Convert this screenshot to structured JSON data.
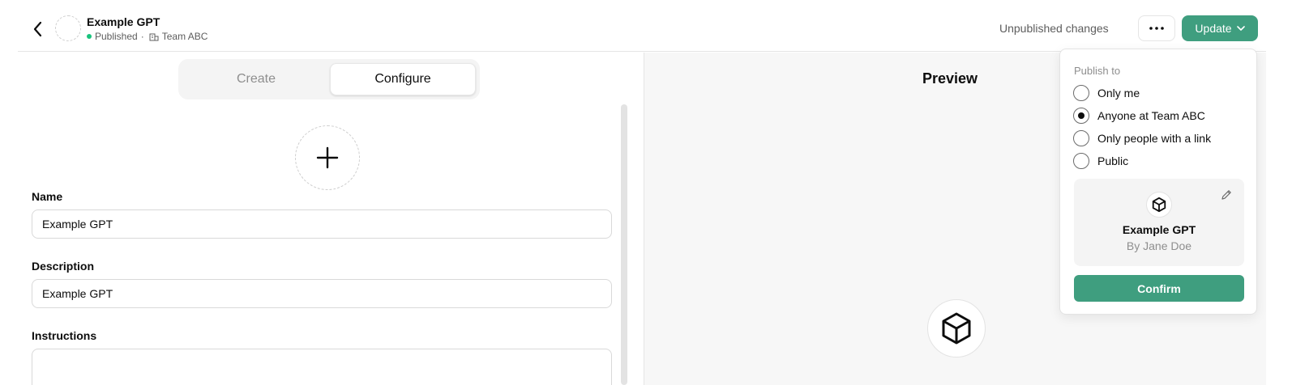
{
  "header": {
    "title": "Example GPT",
    "status": "Published",
    "separator": "·",
    "team": "Team ABC",
    "unpublished_label": "Unpublished changes",
    "more_icon": "ellipsis-icon",
    "update_label": "Update",
    "status_color": "#19c37d",
    "accent_color": "#3f9e7f"
  },
  "tabs": [
    {
      "label": "Create",
      "active": false
    },
    {
      "label": "Configure",
      "active": true
    }
  ],
  "form": {
    "name_label": "Name",
    "name_value": "Example GPT",
    "description_label": "Description",
    "description_value": "Example GPT",
    "instructions_label": "Instructions"
  },
  "preview": {
    "title": "Preview",
    "logo_icon": "cube-icon"
  },
  "publish": {
    "heading": "Publish to",
    "options": [
      {
        "label": "Only me",
        "selected": false
      },
      {
        "label": "Anyone at Team ABC",
        "selected": true
      },
      {
        "label": "Only people with a link",
        "selected": false
      },
      {
        "label": "Public",
        "selected": false
      }
    ],
    "card": {
      "name": "Example GPT",
      "author": "By Jane Doe",
      "icon": "cube-icon"
    },
    "confirm_label": "Confirm"
  }
}
